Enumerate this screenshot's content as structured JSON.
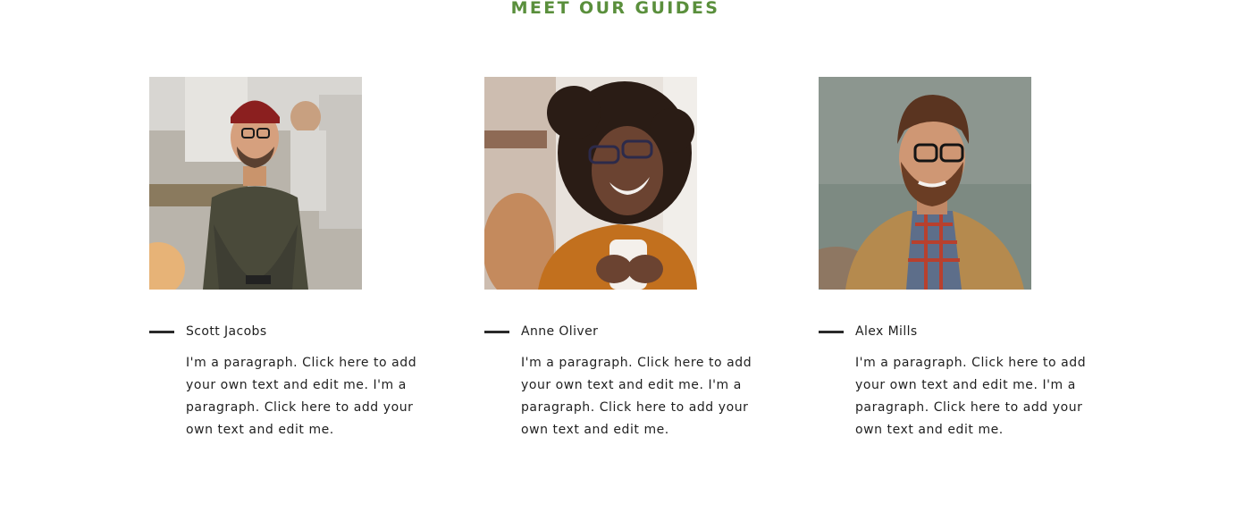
{
  "section": {
    "title": "MEET OUR GUIDES",
    "accent_color": "#5a8f3c"
  },
  "guides": [
    {
      "name": "Scott Jacobs",
      "bio": "I'm a paragraph. Click here to add your own text and edit me. I'm a paragraph. Click here to add your own text and edit me.",
      "photo_icon": "portrait-man-red-beanie-icon"
    },
    {
      "name": "Anne Oliver",
      "bio": "I'm a paragraph. Click here to add your own text and edit me. I'm a paragraph. Click here to add your own text and edit me.",
      "photo_icon": "portrait-woman-curly-hair-icon"
    },
    {
      "name": "Alex Mills",
      "bio": "I'm a paragraph. Click here to add your own text and edit me. I'm a paragraph. Click here to add your own text and edit me.",
      "photo_icon": "portrait-man-glasses-jacket-icon"
    }
  ]
}
